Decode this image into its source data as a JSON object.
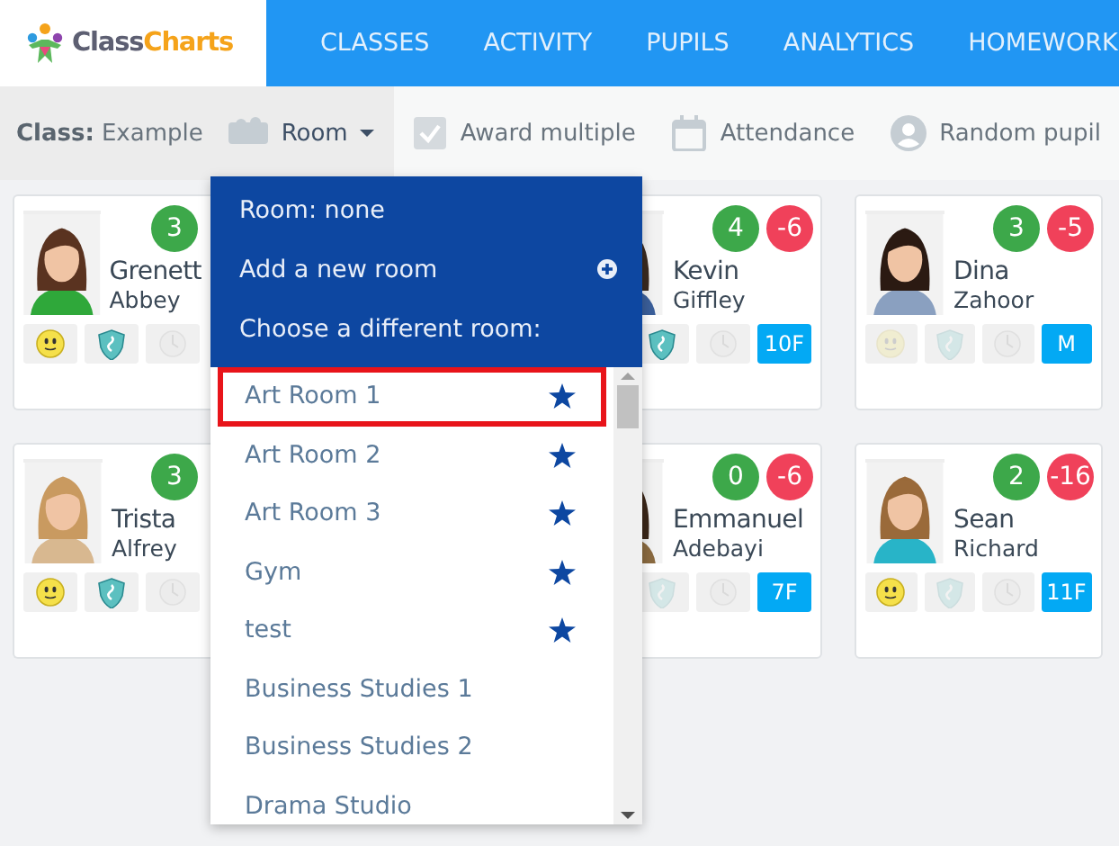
{
  "brand": [
    "Class",
    "Charts"
  ],
  "nav": [
    "CLASSES",
    "ACTIVITY",
    "PUPILS",
    "ANALYTICS",
    "HOMEWORK"
  ],
  "toolbar": {
    "class_label": "Class:",
    "class_value": "Example",
    "items": [
      {
        "kind": "room",
        "label": "Room"
      },
      {
        "kind": "checkbox",
        "label": "Award multiple"
      },
      {
        "kind": "calendar",
        "label": "Attendance"
      },
      {
        "kind": "person",
        "label": "Random pupil"
      }
    ]
  },
  "pupils": [
    {
      "first": "Grenett",
      "last": "Abbey",
      "points": [
        {
          "kind": "positive",
          "value": "3"
        }
      ],
      "icons": [
        {
          "kind": "smiley",
          "on": true
        },
        {
          "kind": "shield",
          "on": true
        },
        {
          "kind": "timer",
          "on": false
        }
      ]
    },
    {
      "first": "Kevin",
      "last": "Giffley",
      "points": [
        {
          "kind": "positive",
          "value": "4"
        },
        {
          "kind": "negative",
          "value": "-6"
        }
      ],
      "icons": [
        {
          "kind": "shield",
          "on": true
        },
        {
          "kind": "timer",
          "on": false
        }
      ],
      "tag": "10F"
    },
    {
      "first": "Dina",
      "last": "Zahoor",
      "points": [
        {
          "kind": "positive",
          "value": "3"
        },
        {
          "kind": "negative",
          "value": "-5"
        }
      ],
      "icons": [
        {
          "kind": "smiley",
          "on": false
        },
        {
          "kind": "shield",
          "on": false
        },
        {
          "kind": "timer",
          "on": false
        }
      ],
      "tag": "M"
    },
    {
      "first": "Trista",
      "last": "Alfrey",
      "points": [
        {
          "kind": "positive",
          "value": "3"
        }
      ],
      "icons": [
        {
          "kind": "smiley",
          "on": true
        },
        {
          "kind": "shield",
          "on": true
        },
        {
          "kind": "timer",
          "on": false
        }
      ]
    },
    {
      "first": "Emmanuel",
      "last": "Adebayi",
      "points": [
        {
          "kind": "positive",
          "value": "0"
        },
        {
          "kind": "negative",
          "value": "-6"
        }
      ],
      "icons": [
        {
          "kind": "shield",
          "on": false
        },
        {
          "kind": "timer",
          "on": false
        }
      ],
      "tag": "7F"
    },
    {
      "first": "Sean",
      "last": "Richard",
      "points": [
        {
          "kind": "positive",
          "value": "2"
        },
        {
          "kind": "negative",
          "value": "-16"
        }
      ],
      "icons": [
        {
          "kind": "smiley",
          "on": true
        },
        {
          "kind": "shield",
          "on": false
        },
        {
          "kind": "timer",
          "on": false
        }
      ],
      "tag": "11F"
    }
  ],
  "room_menu": {
    "header_items": [
      {
        "kind": "text",
        "label": "Room: none"
      },
      {
        "kind": "add",
        "label": "Add a new room"
      },
      {
        "kind": "text",
        "label": "Choose a different room:"
      }
    ],
    "rooms": [
      {
        "label": "Art Room 1",
        "selected": true,
        "starred": true
      },
      {
        "label": "Art Room 2",
        "selected": false,
        "starred": true
      },
      {
        "label": "Art Room 3",
        "selected": false,
        "starred": true
      },
      {
        "label": "Gym",
        "selected": false,
        "starred": true
      },
      {
        "label": "test",
        "selected": false,
        "starred": true
      },
      {
        "label": "Business Studies 1",
        "selected": false,
        "starred": false
      },
      {
        "label": "Business Studies 2",
        "selected": false,
        "starred": false
      },
      {
        "label": "Drama Studio",
        "selected": false,
        "starred": false
      }
    ]
  }
}
